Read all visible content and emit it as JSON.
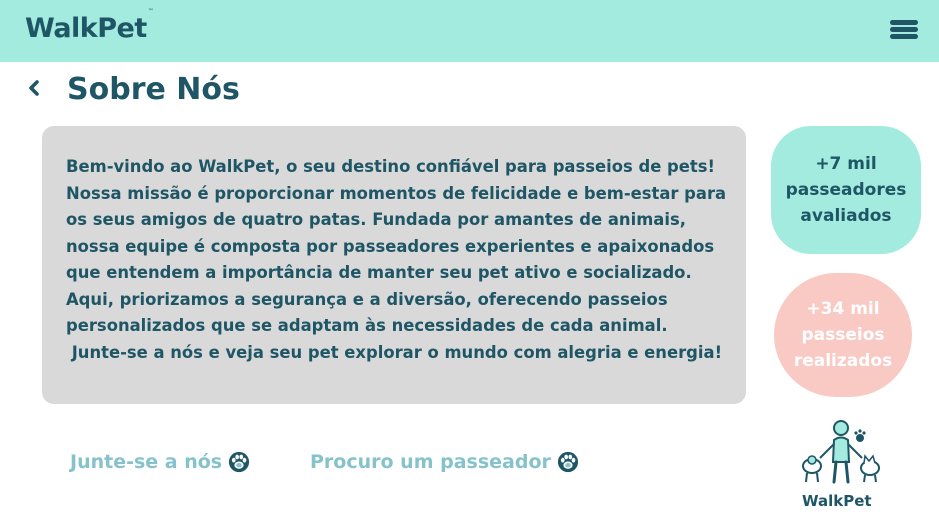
{
  "header": {
    "logo_text": "WalkPet",
    "logo_mark": "™",
    "menu_icon": "hamburger-menu-icon"
  },
  "page": {
    "back_icon": "chevron-left-icon",
    "title": "Sobre Nós"
  },
  "about": {
    "lines": [
      "Bem-vindo ao WalkPet, o seu destino confiável para passeios de pets!",
      "Nossa missão é proporcionar momentos de felicidade e bem-estar para",
      "os seus amigos de quatro patas. Fundada por amantes de animais,",
      "nossa equipe é composta por passeadores experientes e apaixonados",
      "que entendem a importância de manter seu pet ativo e socializado.",
      "Aqui, priorizamos a segurança e a diversão, oferecendo passeios",
      "personalizados que se adaptam às necessidades de cada animal.",
      " Junte-se a nós e veja seu pet explorar o mundo com alegria e energia!"
    ]
  },
  "stats": {
    "walkers": {
      "lines": [
        "+7 mil",
        "passeadores",
        "avaliados"
      ],
      "color": "#a3ebdf"
    },
    "walks": {
      "lines": [
        "+34 mil",
        "passeios",
        "realizados"
      ],
      "color": "#f9c9c4"
    }
  },
  "actions": {
    "join_label": "Junte-se a nós",
    "find_label": "Procuro um passeador",
    "icon": "paw-icon"
  },
  "brand_mark": {
    "text": "WalkPet",
    "icon": "dog-walker-illustration-icon"
  },
  "colors": {
    "header_bg": "#a3ebdf",
    "primary_text": "#1f5666",
    "card_bg": "#d9d9d9",
    "cta_text": "#86c2cc",
    "accent_pink": "#f9c9c4"
  }
}
